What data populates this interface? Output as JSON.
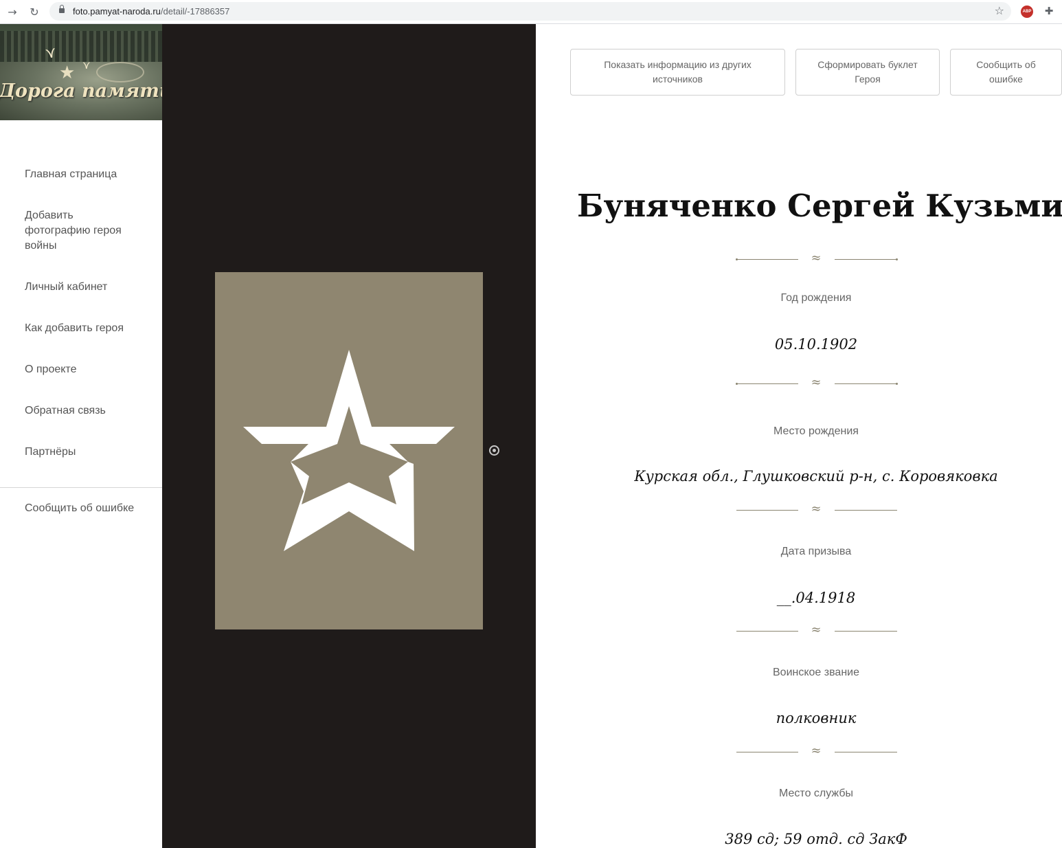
{
  "browser": {
    "url_host": "foto.pamyat-naroda.ru",
    "url_path": "/detail/-17886357",
    "icons": [
      "forward-icon",
      "reload-icon",
      "lock-icon",
      "bookmark-star-icon",
      "adblock-icon",
      "extensions-icon"
    ],
    "adblock_label": "ABP"
  },
  "logo": {
    "text": "Дорога памяти"
  },
  "sidebar": {
    "items": [
      {
        "label": "Главная страница"
      },
      {
        "label": "Добавить фотографию героя войны"
      },
      {
        "label": "Личный кабинет"
      },
      {
        "label": "Как добавить героя"
      },
      {
        "label": "О проекте"
      },
      {
        "label": "Обратная связь"
      },
      {
        "label": "Партнёры"
      }
    ],
    "bottom_item": "Сообщить об ошибке"
  },
  "photo": {
    "placeholder_icon": "army-star-icon",
    "background_color": "#8f8670",
    "star_color": "#ffffff"
  },
  "actions": {
    "sources": "Показать информацию из других источников",
    "booklet": "Сформировать буклет Героя",
    "report_error": "Сообщить об ошибке"
  },
  "hero": {
    "name": "Буняченко Сергей Кузьмич",
    "fields": [
      {
        "label": "Год рождения",
        "value": "05.10.1902"
      },
      {
        "label": "Место рождения",
        "value": "Курская обл., Глушковский р-н, с. Коровяковка"
      },
      {
        "label": "Дата призыва",
        "value": "__.04.1918"
      },
      {
        "label": "Воинское звание",
        "value": "полковник"
      },
      {
        "label": "Место службы",
        "value": "389 сд; 59 отд. сд ЗакФ"
      }
    ]
  },
  "colors": {
    "ornament": "#8a8470",
    "photo_column_bg": "#1f1b1a"
  }
}
